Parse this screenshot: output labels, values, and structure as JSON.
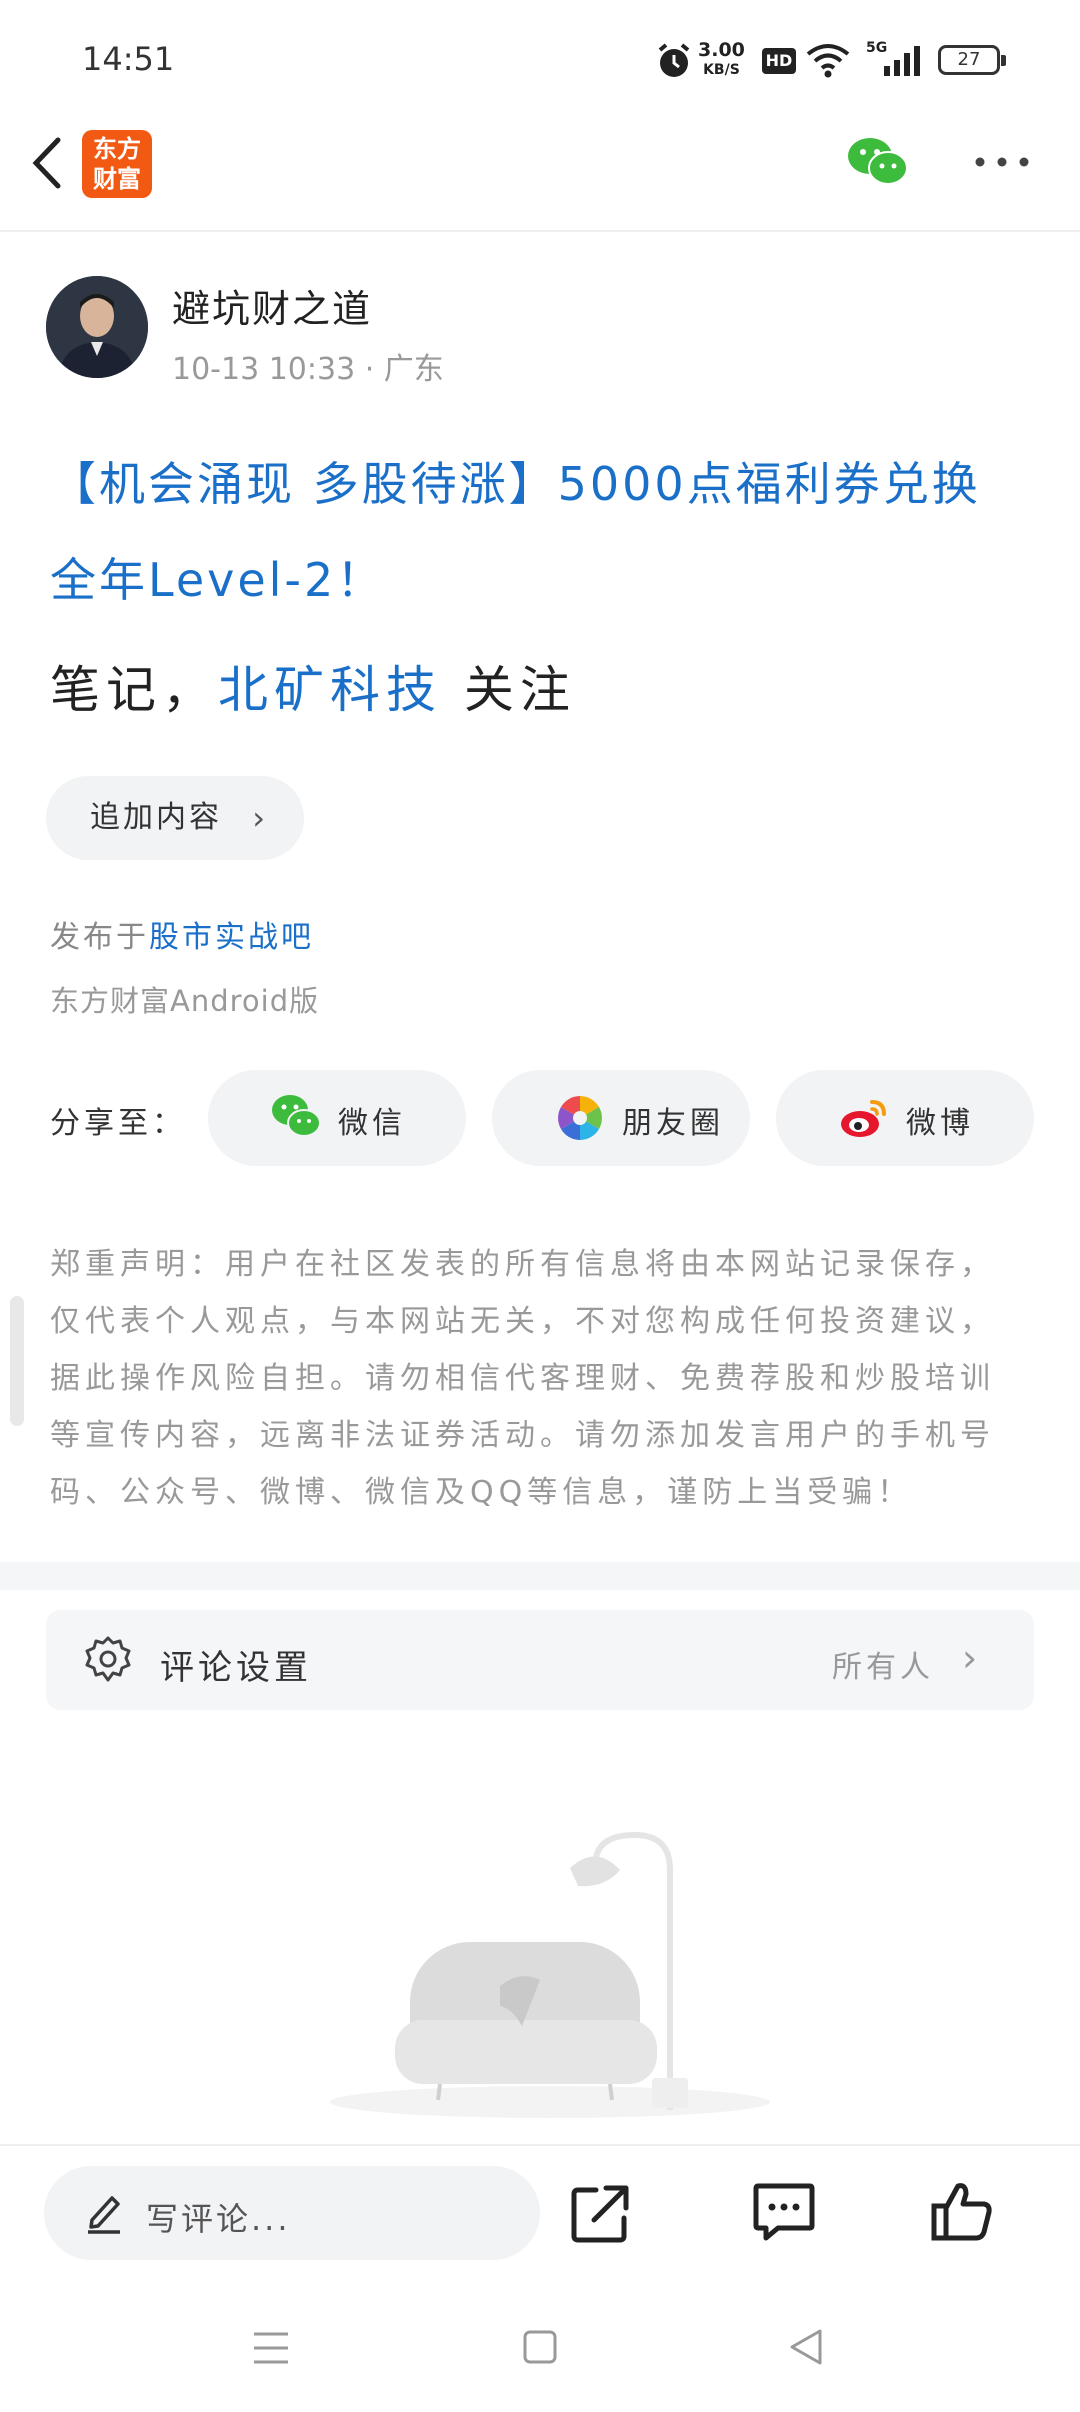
{
  "status_bar": {
    "time": "14:51",
    "speed_value": "3.00",
    "speed_unit": "KB/S",
    "hd": "HD",
    "network": "5G",
    "battery": "27"
  },
  "header": {
    "logo_text": "东方财富"
  },
  "post": {
    "author": "避坑财之道",
    "meta": "10-13 10:33 · 广东",
    "title": "【机会涌现 多股待涨】5000点福利券兑换全年Level-2！",
    "note_prefix": "笔记，",
    "note_stock": "北矿科技",
    "note_suffix": " 关注",
    "add_content_label": "追加内容",
    "published_prefix": "发布于",
    "forum": "股市实战吧",
    "client": "东方财富Android版"
  },
  "share": {
    "label": "分享至：",
    "wechat": "微信",
    "moments": "朋友圈",
    "weibo": "微博"
  },
  "disclaimer": "郑重声明：用户在社区发表的所有信息将由本网站记录保存，仅代表个人观点，与本网站无关，不对您构成任何投资建议，据此操作风险自担。请勿相信代客理财、免费荐股和炒股培训等宣传内容，远离非法证券活动。请勿添加发言用户的手机号码、公众号、微博、微信及QQ等信息，谨防上当受骗！",
  "comment_settings": {
    "label": "评论设置",
    "value": "所有人"
  },
  "bottom_bar": {
    "placeholder": "写评论..."
  },
  "colors": {
    "accent_blue": "#1a6fc9",
    "logo_orange": "#f25a14",
    "wechat_green": "#3dbb3d"
  }
}
